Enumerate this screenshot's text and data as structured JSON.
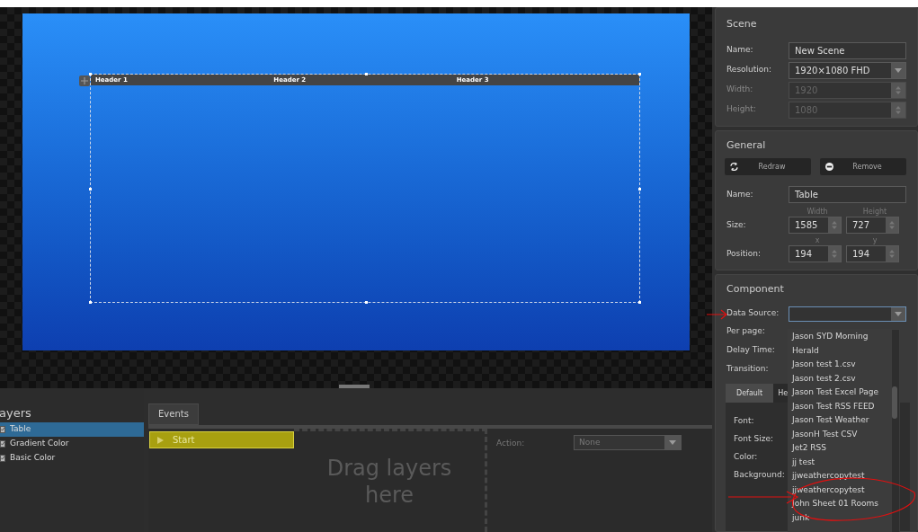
{
  "canvas": {
    "table_headers": [
      "Header 1",
      "Header 2",
      "Header 3"
    ]
  },
  "layers": {
    "title": "ayers",
    "items": [
      {
        "label": "Table",
        "selected": true,
        "checked": true
      },
      {
        "label": "Gradient Color",
        "selected": false,
        "checked": true
      },
      {
        "label": "Basic Color",
        "selected": false,
        "checked": true
      }
    ]
  },
  "events": {
    "tab": "Events",
    "items": [
      {
        "label": "Start",
        "selected": true
      }
    ],
    "drop_hint": "Drag layers here",
    "action_label": "Action:",
    "action_value": "None"
  },
  "scene": {
    "title": "Scene",
    "fields": [
      {
        "kind": "text",
        "label": "Name:",
        "value": "New Scene",
        "disabled": false
      },
      {
        "kind": "select",
        "label": "Resolution:",
        "value": "1920×1080 FHD",
        "disabled": false
      },
      {
        "kind": "spin",
        "label": "Width:",
        "value": "1920",
        "disabled": true
      },
      {
        "kind": "spin",
        "label": "Height:",
        "value": "1080",
        "disabled": true
      }
    ]
  },
  "general": {
    "title": "General",
    "buttons": [
      {
        "kind": "redraw",
        "label": "Redraw"
      },
      {
        "kind": "remove",
        "label": "Remove"
      }
    ],
    "name_label": "Name:",
    "name_value": "Table",
    "size": {
      "label": "Size:",
      "a_label": "Width",
      "b_label": "Height",
      "a": "1585",
      "b": "727"
    },
    "position": {
      "label": "Position:",
      "a_label": "x",
      "b_label": "y",
      "a": "194",
      "b": "194"
    }
  },
  "component": {
    "title": "Component",
    "data_source_label": "Data Source:",
    "labels": [
      "Per page:",
      "Delay Time:",
      "Transition:"
    ],
    "tabs": [
      {
        "label": "Default",
        "selected": false
      },
      {
        "label": "He",
        "selected": true
      }
    ],
    "style_labels": [
      "Font:",
      "Font Size:",
      "Color:",
      "Background:"
    ],
    "dropdown_items": [
      "Jason SYD Morning",
      "Herald",
      "Jason test 1.csv",
      "Jason test 2.csv",
      "Jason Test Excel Page",
      "Jason Test RSS FEED",
      "Jason Test Weather",
      "JasonH Test CSV",
      "Jet2 RSS",
      "jj test",
      "jjweathercopytest",
      "jjweathercopytest",
      "John Sheet 01 Rooms",
      "junk"
    ]
  }
}
